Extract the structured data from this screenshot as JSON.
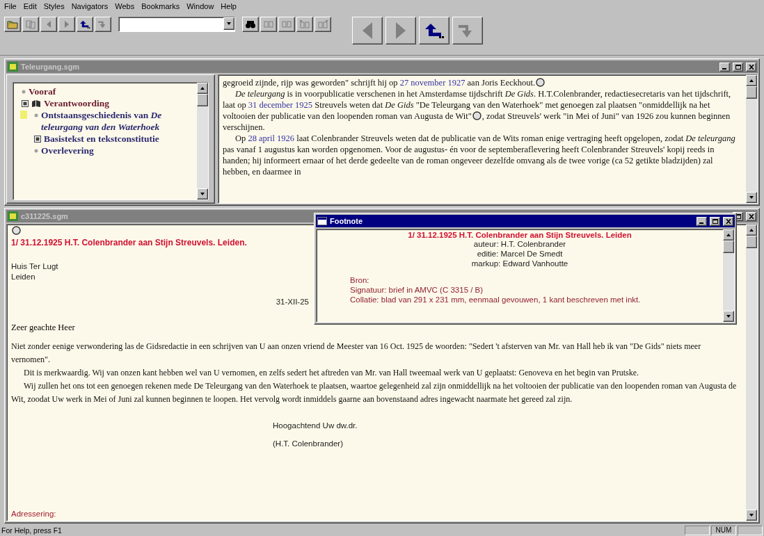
{
  "menu": [
    "File",
    "Edit",
    "Styles",
    "Navigators",
    "Webs",
    "Bookmarks",
    "Window",
    "Help"
  ],
  "toolbar": {
    "left_buttons": [
      {
        "kind": "open",
        "disabled": false
      },
      {
        "kind": "copy",
        "disabled": true
      },
      {
        "kind": "back",
        "disabled": true
      },
      {
        "kind": "forward",
        "disabled": true
      },
      {
        "kind": "up",
        "disabled": false
      },
      {
        "kind": "down",
        "disabled": true
      }
    ],
    "search_buttons": [
      {
        "kind": "find",
        "disabled": false
      },
      {
        "kind": "prev-hit",
        "disabled": true
      },
      {
        "kind": "next-hit",
        "disabled": true
      },
      {
        "kind": "first-hit",
        "disabled": true
      },
      {
        "kind": "last-hit",
        "disabled": true
      }
    ],
    "big_buttons": [
      {
        "kind": "back",
        "disabled": true
      },
      {
        "kind": "forward",
        "disabled": true
      },
      {
        "kind": "up",
        "disabled": false
      },
      {
        "kind": "down",
        "disabled": true
      }
    ]
  },
  "top_window": {
    "title": "Teleurgang.sgm",
    "active": false,
    "toc": [
      {
        "label": "Vooraf",
        "expandable": false
      },
      {
        "label": "Verantwoording",
        "expandable": true,
        "children": [
          {
            "label": "Ontstaansgeschiedenis van *De teleurgang van den Waterhoek*",
            "expandable": false,
            "selected": true
          },
          {
            "label": "Basistekst en tekstconstitutie",
            "expandable": true,
            "selected": false
          },
          {
            "label": "Overlevering",
            "expandable": false,
            "selected": false
          }
        ]
      }
    ],
    "paragraphs": [
      {
        "indented": false,
        "segments": [
          {
            "kind": "text",
            "text": "gegroeid zijnde, rijp was geworden\" schrijft hij op "
          },
          {
            "kind": "date",
            "text": "27 november 1927"
          },
          {
            "kind": "text",
            "text": " aan Joris Eeckhout."
          },
          {
            "kind": "note"
          }
        ]
      },
      {
        "indented": true,
        "segments": [
          {
            "kind": "italic",
            "text": "De teleurgang"
          },
          {
            "kind": "text",
            "text": " is in voorpublicatie verschenen in het Amsterdamse tijdschrift "
          },
          {
            "kind": "italic",
            "text": "De Gids"
          },
          {
            "kind": "text",
            "text": ". H.T.Colenbrander, redactiesecretaris van het tijdschrift, laat op "
          },
          {
            "kind": "date",
            "text": "31 december 1925"
          },
          {
            "kind": "text",
            "text": " Streuvels weten dat "
          },
          {
            "kind": "italic",
            "text": "De Gids"
          },
          {
            "kind": "text",
            "text": " \"De Teleurgang van den Waterhoek\" met genoegen zal plaatsen \"onmiddellijk na het voltooien der publicatie van den loopenden roman van Augusta de Wit\""
          },
          {
            "kind": "note"
          },
          {
            "kind": "text",
            "text": ", zodat Streuvels' werk \"in Mei of Juni\" van 1926 zou kunnen beginnen verschijnen."
          }
        ]
      },
      {
        "indented": true,
        "segments": [
          {
            "kind": "text",
            "text": "Op "
          },
          {
            "kind": "date",
            "text": "28 april 1926"
          },
          {
            "kind": "text",
            "text": " laat Colenbrander Streuvels weten dat de publicatie van de Wits roman enige vertraging heeft opgelopen, zodat "
          },
          {
            "kind": "italic",
            "text": "De teleurgang"
          },
          {
            "kind": "text",
            "text": " pas vanaf 1 augustus kan worden opgenomen. Voor de augustus- én voor de septemberaflevering heeft Colenbrander Streuvels' kopij reeds in handen; hij informeert ernaar of het derde gedeelte van de roman ongeveer dezelfde omvang als de twee vorige (ca 52 getikte bladzijden) zal hebben, en daarmee in"
          }
        ]
      }
    ]
  },
  "bottom_window": {
    "title": "c311225.sgm",
    "active": false,
    "heading": "1/ 31.12.1925 H.T. Colenbrander aan Stijn Streuvels. Leiden.",
    "address": [
      "Huis Ter Lugt",
      "Leiden"
    ],
    "date": "31-XII-25",
    "salutation": "Zeer geachte Heer",
    "paragraphs": [
      {
        "indented": false,
        "text": "Niet zonder eenige verwondering las de Gidsredactie in een schrijven van U aan onzen vriend de Meester van 16 Oct. 1925 de woorden: \"Sedert 't afsterven van Mr. van Hall heb ik van \"De Gids\" niets meer vernomen\"."
      },
      {
        "indented": true,
        "text": "Dit is merkwaardig. Wij van onzen kant hebben wel van U vernomen, en zelfs sedert het aftreden van Mr. van Hall tweemaal werk van U geplaatst: Genoveva en het begin van Prutske."
      },
      {
        "indented": true,
        "text": "Wij zullen het ons tot een genoegen rekenen mede De Teleurgang van den Waterhoek te plaatsen, waartoe gelegenheid zal zijn onmiddellijk na het voltooien der publicatie van den loopenden roman van Augusta de Wit, zoodat Uw werk in Mei of Juni zal kunnen beginnen te loopen. Het vervolg wordt inmiddels gaarne aan bovenstaand adres ingewacht naarmate het gereed zal zijn."
      }
    ],
    "closing": [
      "Hoogachtend Uw dw.dr.",
      "(H.T. Colenbrander)"
    ],
    "footer": "Adressering:"
  },
  "footnote": {
    "title": "Footnote",
    "active": true,
    "heading": "1/ 31.12.1925 H.T. Colenbrander aan Stijn Streuvels. Leiden",
    "credits": [
      "auteur: H.T. Colenbrander",
      "editie: Marcel De Smedt",
      "markup: Edward Vanhoutte"
    ],
    "details": [
      "Bron:",
      "Signatuur: brief in AMVC (C 3315 / B)",
      "Collatie: blad van 291 x 231 mm, eenmaal gevouwen, 1 kant beschreven met inkt."
    ]
  },
  "status_bar": {
    "message": "For Help, press F1",
    "indicator": "NUM"
  }
}
